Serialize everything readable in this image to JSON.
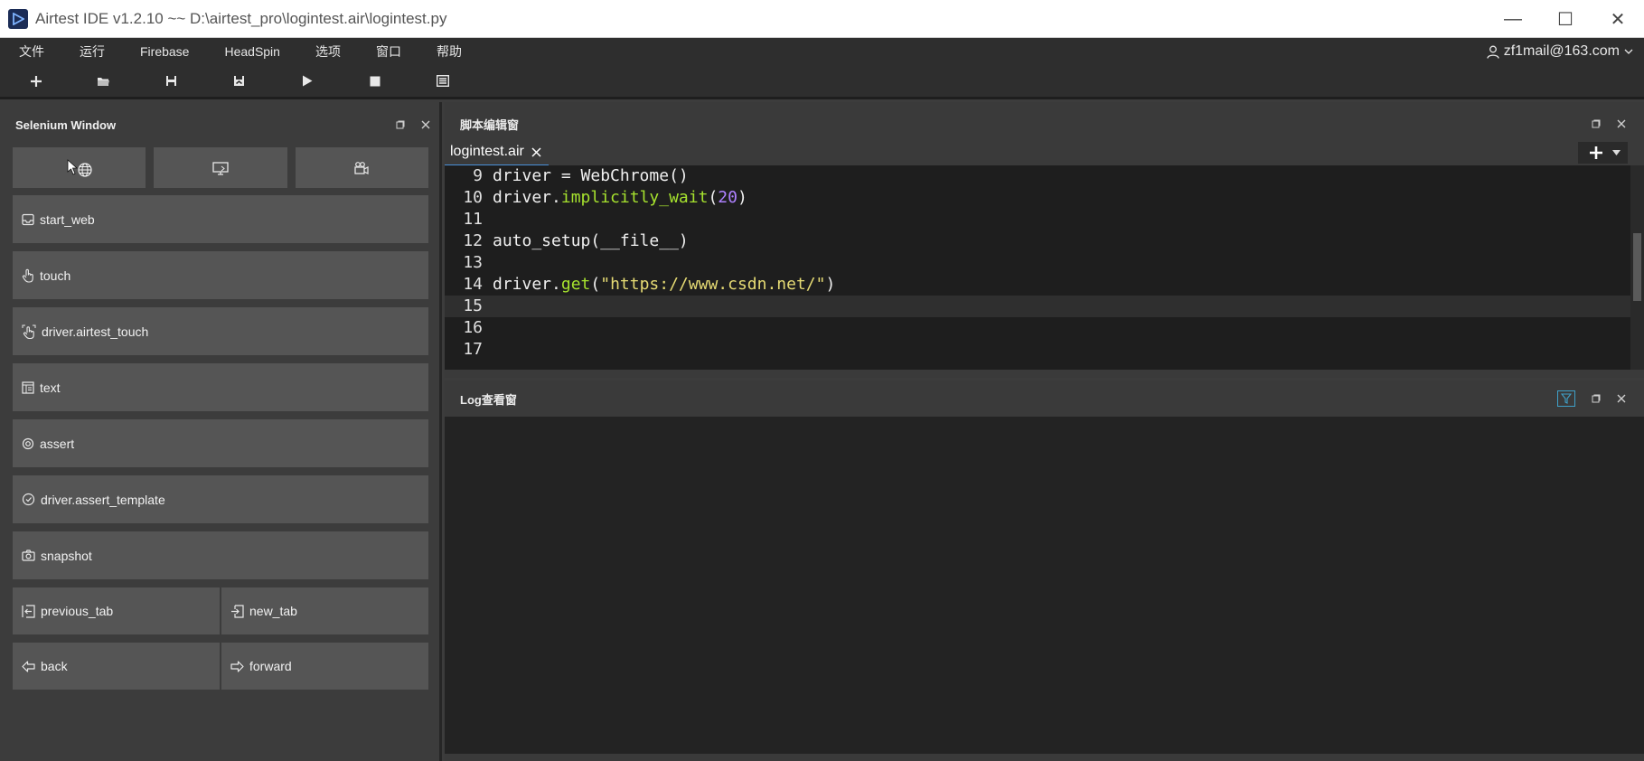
{
  "window": {
    "title": "Airtest IDE v1.2.10 ~~ D:\\airtest_pro\\logintest.air\\logintest.py",
    "minimize": "—",
    "maximize": "☐",
    "close": "✕"
  },
  "menu": [
    "文件",
    "运行",
    "Firebase",
    "HeadSpin",
    "选项",
    "窗口",
    "帮助"
  ],
  "user": {
    "email": "zf1mail@163.com"
  },
  "toolbar": {
    "buttons": [
      "new-icon",
      "open-folder-icon",
      "save-icon",
      "save-all-icon",
      "run-icon",
      "stop-icon",
      "log-icon"
    ]
  },
  "selenium_panel": {
    "title": "Selenium Window",
    "mode_buttons": [
      "web-globe-icon",
      "screen-icon",
      "record-icon"
    ],
    "commands": [
      "start_web",
      "touch",
      "driver.airtest_touch",
      "text",
      "assert",
      "driver.assert_template",
      "snapshot"
    ],
    "paired": [
      [
        "previous_tab",
        "new_tab"
      ],
      [
        "back",
        "forward"
      ]
    ]
  },
  "editor": {
    "title": "脚本编辑窗",
    "tab": "logintest.air",
    "lines": [
      {
        "n": "9",
        "parts": [
          [
            "driver = WebChrome()",
            ""
          ]
        ]
      },
      {
        "n": "10",
        "parts": [
          [
            "driver",
            ""
          ],
          [
            ".",
            "dot"
          ],
          [
            "implicitly_wait",
            "method"
          ],
          [
            "(",
            ""
          ],
          [
            "20",
            "num"
          ],
          [
            ")",
            ""
          ]
        ]
      },
      {
        "n": "11",
        "parts": [
          [
            "",
            ""
          ]
        ]
      },
      {
        "n": "12",
        "parts": [
          [
            "auto_setup(__file__)",
            ""
          ]
        ]
      },
      {
        "n": "13",
        "parts": [
          [
            "",
            ""
          ]
        ]
      },
      {
        "n": "14",
        "parts": [
          [
            "driver",
            ""
          ],
          [
            ".",
            "dot"
          ],
          [
            "get",
            "method"
          ],
          [
            "(",
            ""
          ],
          [
            "\"https://www.csdn.net/\"",
            "str"
          ],
          [
            ")",
            ""
          ]
        ]
      },
      {
        "n": "15",
        "parts": [
          [
            "",
            ""
          ]
        ]
      },
      {
        "n": "16",
        "parts": [
          [
            "",
            ""
          ]
        ]
      },
      {
        "n": "17",
        "parts": [
          [
            "",
            ""
          ]
        ]
      }
    ],
    "active_line": "15"
  },
  "log_panel": {
    "title": "Log查看窗"
  },
  "colors": {
    "method": "#a6e22e",
    "number": "#ae81ff",
    "string": "#e6db74"
  }
}
